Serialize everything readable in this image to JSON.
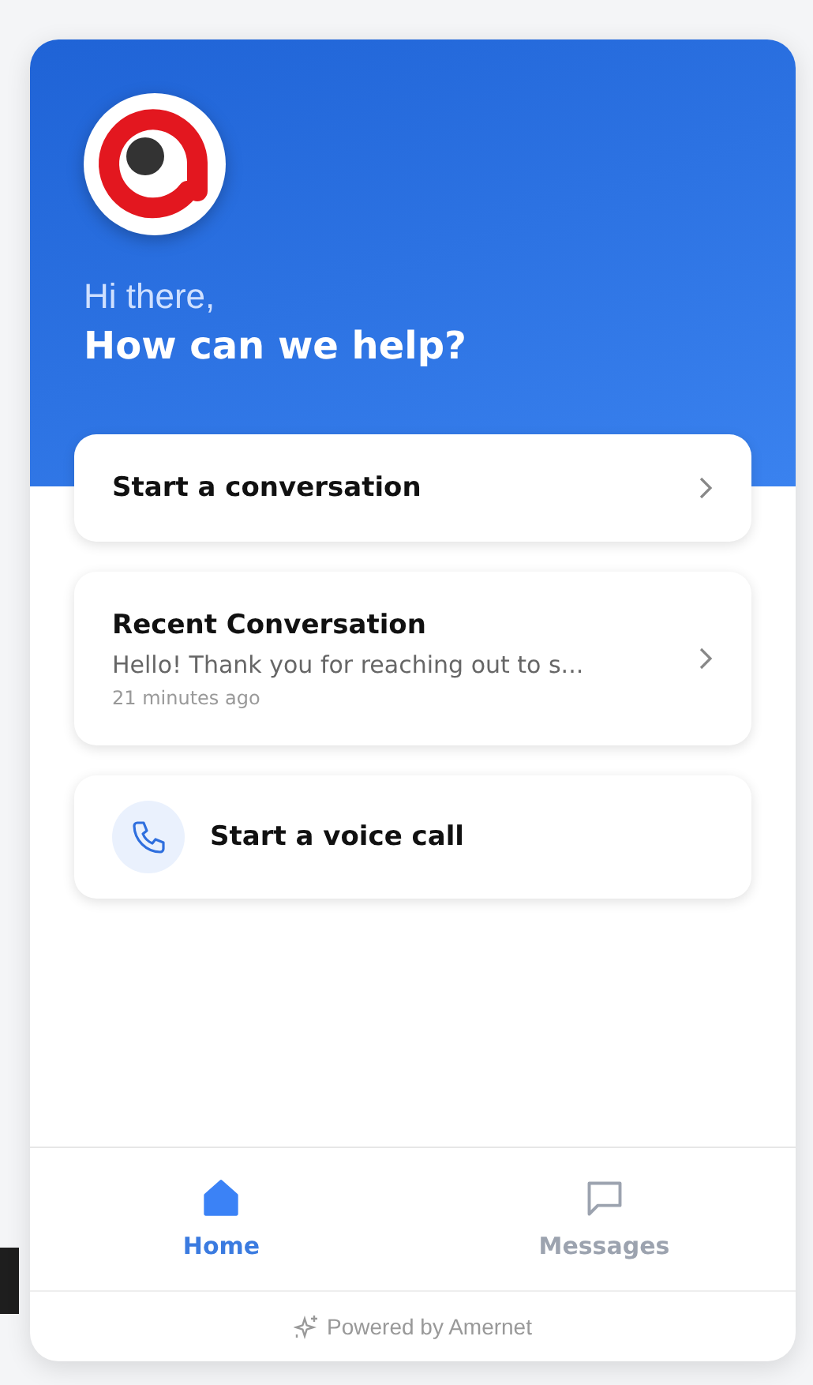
{
  "header": {
    "greeting": "Hi there,",
    "headline": "How can we help?"
  },
  "cards": [
    {
      "kind": "link",
      "title": "Start a conversation"
    },
    {
      "kind": "recent",
      "title": "Recent Conversation",
      "preview": "Hello! Thank you for reaching out to s...",
      "time": "21 minutes ago"
    },
    {
      "kind": "call",
      "title": "Start a voice call"
    }
  ],
  "nav": [
    {
      "kind": "home",
      "label": "Home",
      "selected": true
    },
    {
      "kind": "messages",
      "label": "Messages",
      "selected": false
    }
  ],
  "footer": {
    "text": "Powered by Amernet"
  }
}
